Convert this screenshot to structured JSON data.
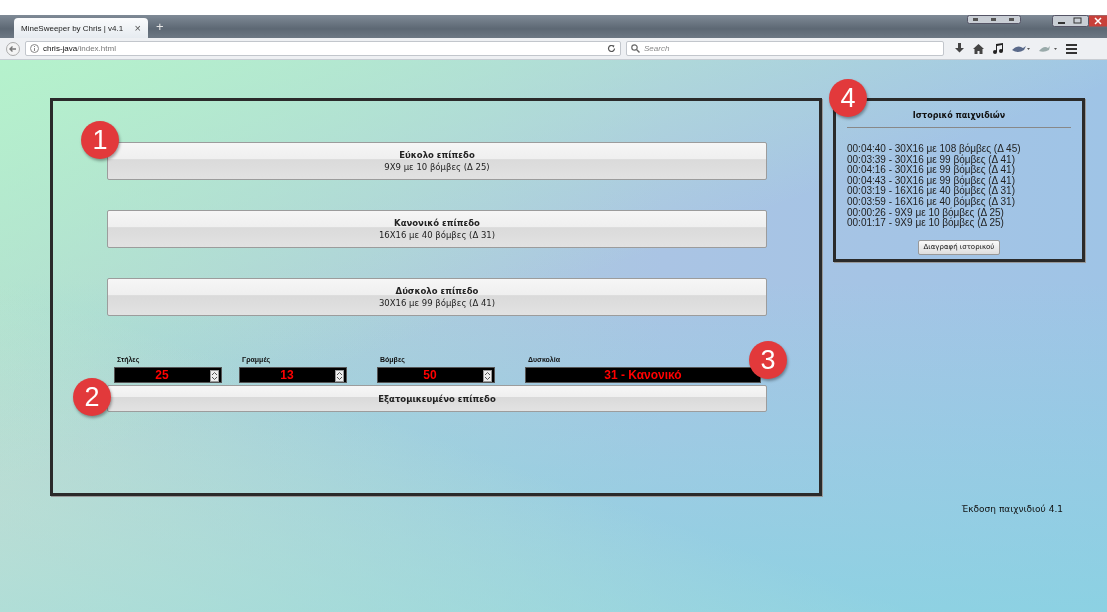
{
  "browser": {
    "tab": {
      "title": "MineSweeper by Chris | v4.1",
      "close": "×"
    },
    "new_tab": "+",
    "address": {
      "host": "chris-java",
      "path": "/index.html"
    },
    "search": {
      "placeholder": "Search"
    }
  },
  "levels": [
    {
      "title": "Εύκολο επίπεδο",
      "detail": "9X9 με 10 βόμβες (Δ 25)"
    },
    {
      "title": "Κανονικό επίπεδο",
      "detail": "16X16 με 40 βόμβες (Δ 31)"
    },
    {
      "title": "Δύσκολο επίπεδο",
      "detail": "30X16 με 99 βόμβες (Δ 41)"
    }
  ],
  "custom": {
    "fields": [
      {
        "label": "Στήλες",
        "value": "25",
        "kind": "spinner"
      },
      {
        "label": "Γραμμές",
        "value": "13",
        "kind": "spinner"
      },
      {
        "label": "Βόμβες",
        "value": "50",
        "kind": "spinner"
      },
      {
        "label": "Δυσκολία",
        "value": "31 - Κανονικό",
        "kind": "readout"
      }
    ],
    "button": "Εξατομικευμένο επίπεδο"
  },
  "history": {
    "title": "Ιστορικό παιχνιδιών",
    "entries": [
      "00:04:40 - 30X16 με 108 βόμβες (Δ 45)",
      "00:03:39 - 30X16 με 99 βόμβες (Δ 41)",
      "00:04:16 - 30X16 με 99 βόμβες (Δ 41)",
      "00:04:43 - 30X16 με 99 βόμβες (Δ 41)",
      "00:03:19 - 16X16 με 40 βόμβες (Δ 31)",
      "00:03:59 - 16X16 με 40 βόμβες (Δ 31)",
      "00:00:26 - 9X9 με 10 βόμβες (Δ 25)",
      "00:01:17 - 9X9 με 10 βόμβες (Δ 25)"
    ],
    "clear_button": "Διαγραφή ιστορικού"
  },
  "version": "Έκδοση παιχνιδιού 4.1",
  "callouts": [
    "1",
    "2",
    "3",
    "4"
  ]
}
